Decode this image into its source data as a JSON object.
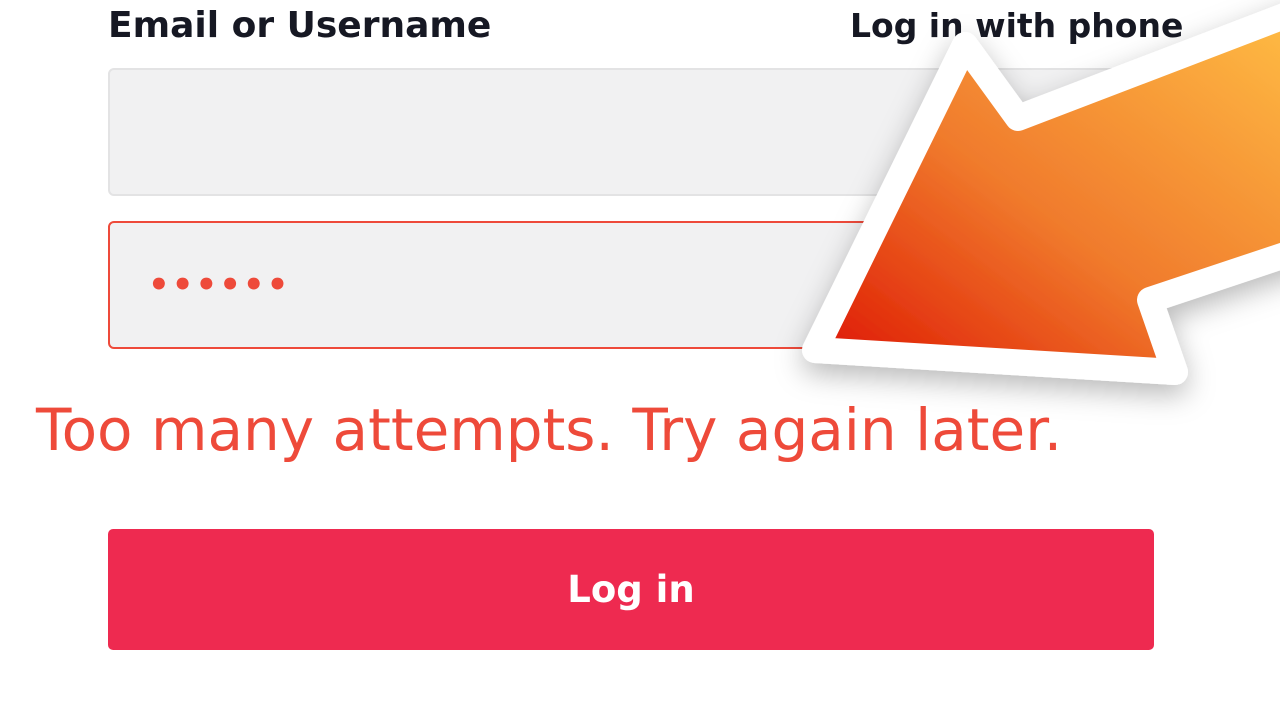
{
  "form": {
    "email_label": "Email or Username",
    "alt_login_link": "Log in with phone",
    "email_value": "",
    "password_mask": "••••••",
    "error_message": "Too many attempts. Try again later.",
    "login_button": "Log in"
  },
  "overlay": {
    "arrow_icon": "arrow-pointing-down-left-icon",
    "arrow_colors": [
      "#ffbe45",
      "#f07a2c",
      "#dd1200"
    ]
  },
  "colors": {
    "error": "#ee4a3a",
    "button": "#ee2a50",
    "field_bg": "#f1f1f2",
    "text": "#161823"
  }
}
